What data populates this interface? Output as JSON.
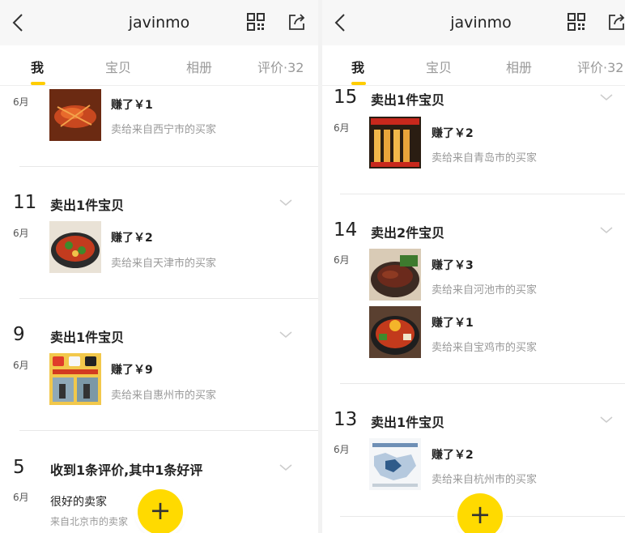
{
  "left": {
    "header": {
      "title": "javinmo"
    },
    "tabs": [
      "我",
      "宝贝",
      "相册",
      "评价·32"
    ],
    "top_item": {
      "month": "6月",
      "earned": "赚了￥1",
      "buyer": "卖给来自西宁市的买家"
    },
    "groups": [
      {
        "day": "11",
        "month": "6月",
        "headline": "卖出1件宝贝",
        "earned": "赚了￥2",
        "buyer": "卖给来自天津市的买家"
      },
      {
        "day": "9",
        "month": "6月",
        "headline": "卖出1件宝贝",
        "earned": "赚了￥9",
        "buyer": "卖给来自惠州市的买家"
      }
    ],
    "review_group": {
      "day": "5",
      "month": "6月",
      "headline": "收到1条评价,其中1条好评",
      "text": "很好的卖家",
      "sub": "来自北京市的卖家"
    },
    "fab_label": "+"
  },
  "right": {
    "header": {
      "title": "javinmo"
    },
    "tabs": [
      "我",
      "宝贝",
      "相册",
      "评价·32"
    ],
    "groups": [
      {
        "day": "15",
        "month": "6月",
        "headline": "卖出1件宝贝",
        "items": [
          {
            "earned": "赚了￥2",
            "buyer": "卖给来自青岛市的买家"
          }
        ]
      },
      {
        "day": "14",
        "month": "6月",
        "headline": "卖出2件宝贝",
        "items": [
          {
            "earned": "赚了￥3",
            "buyer": "卖给来自河池市的买家"
          },
          {
            "earned": "赚了￥1",
            "buyer": "卖给来自宝鸡市的买家"
          }
        ]
      },
      {
        "day": "13",
        "month": "6月",
        "headline": "卖出1件宝贝",
        "items": [
          {
            "earned": "赚了￥2",
            "buyer": "卖给来自杭州市的买家"
          }
        ]
      }
    ],
    "fab_label": "+"
  },
  "colors": {
    "accent": "#ffcd00",
    "fab": "#ffda00",
    "muted": "#999999"
  }
}
